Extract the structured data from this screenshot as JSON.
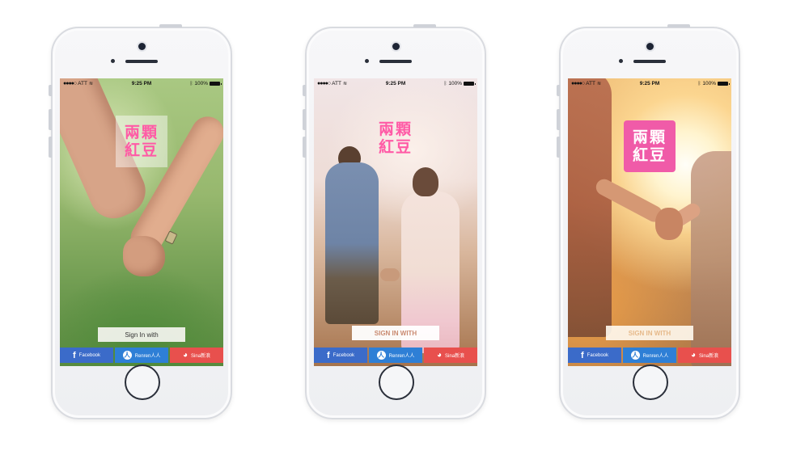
{
  "status_bar": {
    "carrier": "ATT",
    "time": "9:25 PM",
    "battery": "100%"
  },
  "logo": {
    "line1": "兩顆",
    "line2": "紅豆"
  },
  "screens": [
    {
      "signin_label": "Sign In with"
    },
    {
      "signin_label": "SIGN IN WITH"
    },
    {
      "signin_label": "SIGN IN WITH"
    }
  ],
  "social": {
    "facebook": "Facebook",
    "renren": "Renren人人",
    "sina": "Sina新浪"
  },
  "colors": {
    "logo_pink": "#ff5aa6",
    "facebook_blue": "#3b6bc9",
    "renren_blue": "#2e7fd6",
    "sina_red": "#e8504d"
  },
  "icons": [
    "facebook-icon",
    "renren-icon",
    "sina-weibo-icon",
    "wifi-icon",
    "bluetooth-icon",
    "battery-icon"
  ]
}
